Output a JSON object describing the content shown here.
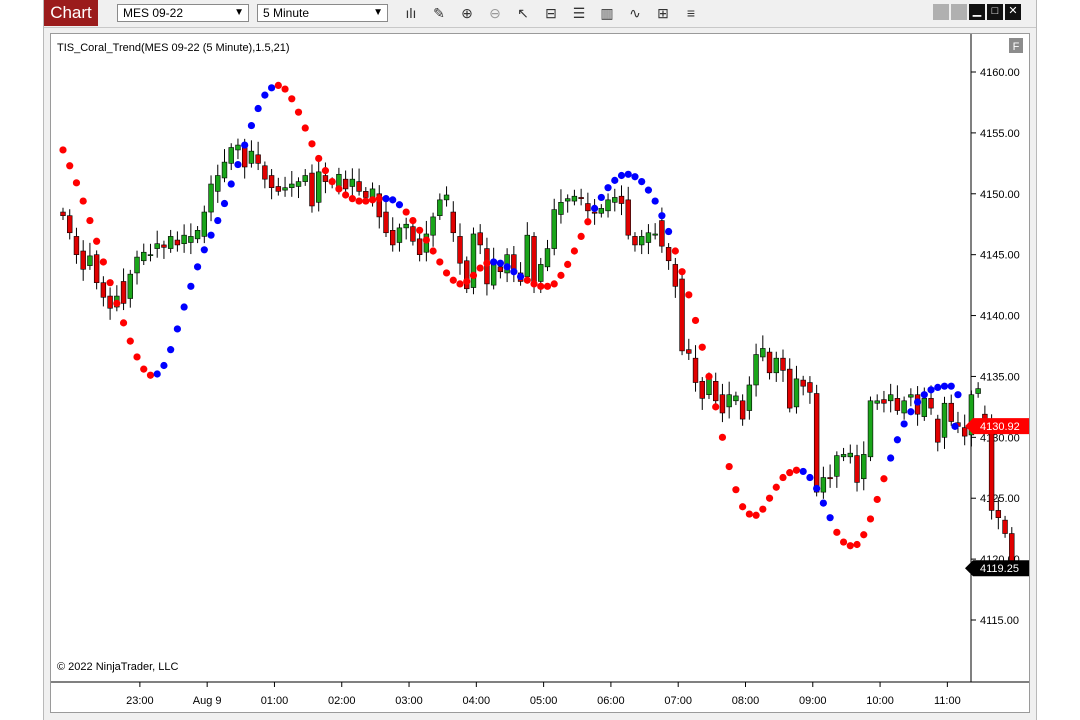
{
  "toolbar": {
    "tab_label": "Chart",
    "instrument": "MES 09-22",
    "interval": "5 Minute",
    "tools": [
      "bar-type-icon",
      "draw-tool-icon",
      "zoom-in-icon",
      "zoom-out-icon",
      "pointer-icon",
      "data-box-icon",
      "properties-icon",
      "indicators-icon",
      "strategies-icon",
      "chart-trader-icon",
      "templates-icon"
    ],
    "window_buttons": [
      "tile-icon",
      "tile-icon",
      "minimize-icon",
      "maximize-icon",
      "close-icon"
    ]
  },
  "panel": {
    "indicator_label": "TIS_Coral_Trend(MES 09-22 (5 Minute),1.5,21)",
    "copyright": "© 2022 NinjaTrader, LLC",
    "f_badge": "F"
  },
  "colors": {
    "up": "#1aa51a",
    "down": "#e00000",
    "dot_up": "#0000ff",
    "dot_down": "#ff0000",
    "brand": "#9b1c1c"
  },
  "chart_data": {
    "type": "candlestick",
    "title": "",
    "y_ticks": [
      "4160.00",
      "4155.00",
      "4150.00",
      "4145.00",
      "4140.00",
      "4135.00",
      "4130.00",
      "4125.00",
      "4120.00",
      "4115.00"
    ],
    "x_ticks": [
      "23:00",
      "Aug 9",
      "01:00",
      "02:00",
      "03:00",
      "04:00",
      "05:00",
      "06:00",
      "07:00",
      "08:00",
      "09:00",
      "10:00",
      "11:00"
    ],
    "ylim": [
      4111,
      4163
    ],
    "price_labels": [
      {
        "text": "4130.92",
        "value": 4130.92,
        "color": "#ff0000"
      },
      {
        "text": "4119.25",
        "value": 4119.25,
        "color": "#000000"
      }
    ],
    "coral_trend": [
      4153.6,
      4152.3,
      4150.9,
      4149.4,
      4147.8,
      4146.1,
      4144.4,
      4142.7,
      4141.0,
      4139.4,
      4137.9,
      4136.6,
      4135.6,
      4135.1,
      4135.2,
      4135.9,
      4137.2,
      4138.9,
      4140.7,
      4142.4,
      4144.0,
      4145.4,
      4146.6,
      4147.8,
      4149.2,
      4150.8,
      4152.4,
      4154.0,
      4155.6,
      4157.0,
      4158.1,
      4158.7,
      4158.9,
      4158.6,
      4157.8,
      4156.7,
      4155.4,
      4154.1,
      4152.9,
      4151.9,
      4151.0,
      4150.4,
      4149.9,
      4149.6,
      4149.4,
      4149.4,
      4149.5,
      4149.6,
      4149.6,
      4149.5,
      4149.1,
      4148.5,
      4147.8,
      4147.0,
      4146.2,
      4145.3,
      4144.4,
      4143.5,
      4142.9,
      4142.6,
      4142.8,
      4143.3,
      4143.9,
      4144.3,
      4144.4,
      4144.3,
      4144.0,
      4143.6,
      4143.2,
      4142.9,
      4142.6,
      4142.4,
      4142.4,
      4142.6,
      4143.3,
      4144.2,
      4145.3,
      4146.5,
      4147.7,
      4148.8,
      4149.7,
      4150.5,
      4151.1,
      4151.5,
      4151.6,
      4151.4,
      4151.0,
      4150.3,
      4149.4,
      4148.2,
      4146.9,
      4145.3,
      4143.6,
      4141.7,
      4139.6,
      4137.4,
      4135.0,
      4132.5,
      4130.0,
      4127.6,
      4125.7,
      4124.3,
      4123.7,
      4123.6,
      4124.1,
      4125.0,
      4125.9,
      4126.7,
      4127.1,
      4127.3,
      4127.2,
      4126.7,
      4125.8,
      4124.6,
      4123.4,
      4122.2,
      4121.4,
      4121.1,
      4121.2,
      4122.0,
      4123.3,
      4124.9,
      4126.6,
      4128.3,
      4129.8,
      4131.1,
      4132.1,
      4132.9,
      4133.5,
      4133.9,
      4134.1,
      4134.2,
      4134.2,
      4133.5,
      4130.9
    ],
    "coral_colors": "RRRRRRRRRRRRRRBBBBBBBBBBBBBBBBBBRRRRRRRRRRRRRRRRBBBRRRRRRRRRRRRRBBBBBRRRRRRRRRRBBBBBBBBBBBBRRRRRRRRRRRRRRRRRRRBBBBBRRRRRRRRBBBBBBBBBBBBBBBBBRR",
    "candles": [
      [
        4148.5,
        4148.2
      ],
      [
        4148.2,
        4146.8
      ],
      [
        4146.5,
        4145.0
      ],
      [
        4145.3,
        4143.8
      ],
      [
        4144.1,
        4144.9
      ],
      [
        4145.0,
        4142.7
      ],
      [
        4142.7,
        4141.5
      ],
      [
        4141.6,
        4140.6
      ],
      [
        4140.7,
        4141.6
      ],
      [
        4142.8,
        4141.0
      ],
      [
        4141.4,
        4143.4
      ],
      [
        4143.5,
        4144.8
      ],
      [
        4144.5,
        4145.2
      ],
      [
        4145.0,
        4145.0
      ],
      [
        4145.5,
        4145.9
      ],
      [
        4145.8,
        4145.6
      ],
      [
        4145.5,
        4146.5
      ],
      [
        4146.2,
        4145.8
      ],
      [
        4145.9,
        4146.6
      ],
      [
        4146.0,
        4146.5
      ],
      [
        4146.3,
        4147.0
      ],
      [
        4146.5,
        4148.5
      ],
      [
        4148.5,
        4150.8
      ],
      [
        4150.2,
        4151.5
      ],
      [
        4151.3,
        4152.6
      ],
      [
        4152.5,
        4153.8
      ],
      [
        4153.6,
        4154.0
      ],
      [
        4153.8,
        4152.2
      ],
      [
        4152.5,
        4153.5
      ],
      [
        4153.2,
        4152.5
      ],
      [
        4152.3,
        4151.2
      ],
      [
        4151.5,
        4150.5
      ],
      [
        4150.6,
        4150.2
      ],
      [
        4150.3,
        4150.5
      ],
      [
        4150.5,
        4150.8
      ],
      [
        4150.6,
        4151.0
      ],
      [
        4151.0,
        4151.5
      ],
      [
        4151.7,
        4149.0
      ],
      [
        4149.3,
        4151.8
      ],
      [
        4151.5,
        4151.0
      ],
      [
        4151.0,
        4150.8
      ],
      [
        4150.5,
        4151.6
      ],
      [
        4151.2,
        4150.4
      ],
      [
        4150.6,
        4151.2
      ],
      [
        4151.0,
        4150.2
      ],
      [
        4150.2,
        4149.7
      ],
      [
        4149.7,
        4150.4
      ],
      [
        4150.0,
        4148.1
      ],
      [
        4148.5,
        4146.8
      ],
      [
        4147.0,
        4145.8
      ],
      [
        4146.0,
        4147.2
      ],
      [
        4147.2,
        4147.5
      ],
      [
        4147.3,
        4146.1
      ],
      [
        4146.3,
        4145.0
      ],
      [
        4145.2,
        4146.7
      ],
      [
        4146.6,
        4148.1
      ],
      [
        4148.2,
        4149.5
      ],
      [
        4149.5,
        4149.9
      ],
      [
        4148.5,
        4146.8
      ],
      [
        4146.5,
        4144.3
      ],
      [
        4144.5,
        4142.2
      ],
      [
        4142.3,
        4146.7
      ],
      [
        4146.8,
        4145.8
      ],
      [
        4145.5,
        4142.6
      ],
      [
        4142.5,
        4144.5
      ],
      [
        4144.0,
        4143.6
      ],
      [
        4143.5,
        4145.0
      ],
      [
        4145.0,
        4143.7
      ],
      [
        4143.5,
        4142.8
      ],
      [
        4143.2,
        4146.6
      ],
      [
        4146.5,
        4142.6
      ],
      [
        4142.8,
        4144.2
      ],
      [
        4144.0,
        4145.5
      ],
      [
        4145.5,
        4148.7
      ],
      [
        4148.3,
        4149.3
      ],
      [
        4149.4,
        4149.6
      ],
      [
        4149.4,
        4149.8
      ],
      [
        4149.7,
        4149.6
      ],
      [
        4149.2,
        4148.6
      ],
      [
        4148.5,
        4148.4
      ],
      [
        4148.4,
        4148.8
      ],
      [
        4148.6,
        4149.5
      ],
      [
        4149.3,
        4149.7
      ],
      [
        4149.8,
        4149.2
      ],
      [
        4149.5,
        4146.6
      ],
      [
        4146.5,
        4145.8
      ],
      [
        4145.8,
        4146.5
      ],
      [
        4146.0,
        4146.8
      ],
      [
        4146.6,
        4146.7
      ],
      [
        4147.8,
        4145.7
      ],
      [
        4145.6,
        4144.5
      ],
      [
        4144.2,
        4142.4
      ],
      [
        4143.0,
        4137.1
      ],
      [
        4137.2,
        4136.9
      ],
      [
        4136.5,
        4134.5
      ],
      [
        4134.6,
        4133.2
      ],
      [
        4133.5,
        4134.8
      ],
      [
        4134.6,
        4133.0
      ],
      [
        4133.5,
        4132.0
      ],
      [
        4132.5,
        4133.5
      ],
      [
        4133.0,
        4133.4
      ],
      [
        4133.0,
        4131.5
      ],
      [
        4132.2,
        4134.3
      ],
      [
        4134.3,
        4136.8
      ],
      [
        4136.6,
        4137.3
      ],
      [
        4137.0,
        4135.3
      ],
      [
        4135.3,
        4136.5
      ],
      [
        4136.5,
        4135.5
      ],
      [
        4135.6,
        4132.4
      ],
      [
        4132.5,
        4134.8
      ],
      [
        4134.7,
        4134.2
      ],
      [
        4134.5,
        4133.7
      ],
      [
        4133.6,
        4125.5
      ],
      [
        4125.5,
        4126.7
      ],
      [
        4126.7,
        4126.6
      ],
      [
        4126.8,
        4128.5
      ],
      [
        4128.4,
        4128.6
      ],
      [
        4128.4,
        4128.7
      ],
      [
        4128.5,
        4126.3
      ],
      [
        4126.6,
        4128.6
      ],
      [
        4128.4,
        4133.0
      ],
      [
        4132.8,
        4133.0
      ],
      [
        4133.1,
        4132.8
      ],
      [
        4133.0,
        4133.5
      ],
      [
        4133.2,
        4132.2
      ],
      [
        4132.0,
        4133.0
      ],
      [
        4133.3,
        4133.5
      ],
      [
        4133.5,
        4131.9
      ],
      [
        4131.7,
        4133.2
      ],
      [
        4133.2,
        4132.4
      ],
      [
        4131.5,
        4129.6
      ],
      [
        4130.0,
        4132.8
      ],
      [
        4132.8,
        4131.3
      ],
      [
        4131.2,
        4130.9
      ],
      [
        4130.8,
        4130.1
      ],
      [
        4130.2,
        4133.5
      ],
      [
        4133.6,
        4134.0
      ],
      [
        4131.9,
        4130.9
      ],
      [
        4131.0,
        4124.0
      ],
      [
        4124.0,
        4123.4
      ],
      [
        4123.2,
        4122.1
      ],
      [
        4122.1,
        4119.3
      ]
    ]
  }
}
